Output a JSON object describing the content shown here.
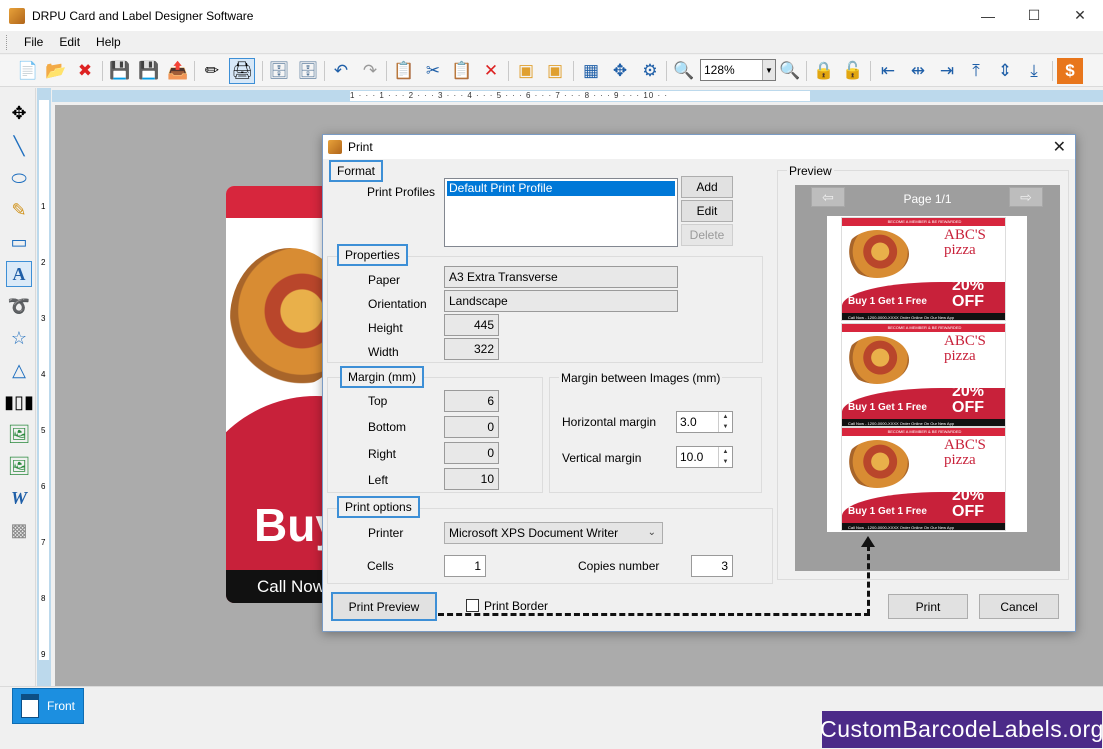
{
  "app": {
    "title": "DRPU Card and Label Designer Software",
    "win_minimize": "—",
    "win_maximize": "☐",
    "win_close": "✕"
  },
  "menu": [
    "File",
    "Edit",
    "Help"
  ],
  "toolbar": {
    "zoom_value": "128%",
    "ruler_marks": "1 · · · 1 · · · 2 · · · 3 · · · 4 · · · 5 · · · 6 · · · 7 · · · 8 · · · 9 · · · 10 · ·"
  },
  "ruler_v_marks": [
    "1",
    "2",
    "3",
    "4",
    "5",
    "6",
    "7",
    "8",
    "9"
  ],
  "canvas": {
    "card_text_buy": "Buy",
    "card_text_call": "Call Now"
  },
  "bottom": {
    "tab_front": "Front",
    "brand": "CustomBarcodeLabels.org"
  },
  "dialog": {
    "title": "Print",
    "format": {
      "heading": "Format",
      "profiles_label": "Print Profiles",
      "profiles": [
        "Default Print Profile"
      ],
      "add": "Add",
      "edit": "Edit",
      "delete": "Delete"
    },
    "properties": {
      "heading": "Properties",
      "paper_label": "Paper",
      "paper_value": "A3 Extra Transverse",
      "orientation_label": "Orientation",
      "orientation_value": "Landscape",
      "height_label": "Height",
      "height_value": "445",
      "width_label": "Width",
      "width_value": "322"
    },
    "margin": {
      "heading": "Margin (mm)",
      "top_label": "Top",
      "top_value": "6",
      "bottom_label": "Bottom",
      "bottom_value": "0",
      "right_label": "Right",
      "right_value": "0",
      "left_label": "Left",
      "left_value": "10"
    },
    "between": {
      "heading": "Margin between Images (mm)",
      "horizontal_label": "Horizontal margin",
      "horizontal_value": "3.0",
      "vertical_label": "Vertical margin",
      "vertical_value": "10.0"
    },
    "print_options": {
      "heading": "Print options",
      "printer_label": "Printer",
      "printer_value": "Microsoft XPS Document Writer",
      "cells_label": "Cells",
      "cells_value": "1",
      "copies_label": "Copies number",
      "copies_value": "3"
    },
    "preview": {
      "heading": "Preview",
      "page_label": "Page 1/1",
      "card": {
        "band": "BECOME A MEMBER & BE REWARDED",
        "name_line1": "ABC'S",
        "name_line2": "pizza",
        "discount_line1": "20%",
        "discount_line2": "OFF",
        "buy": "Buy 1 Get 1 Free",
        "footer": "Call Now - 1200-0000-XXXX      Order Online On Our New App"
      }
    },
    "print_preview_button": "Print Preview",
    "print_border_label": "Print Border",
    "print_button": "Print",
    "cancel_button": "Cancel"
  },
  "colors": {
    "accent": "#3d8fd6",
    "brand_bg": "#4b2a88",
    "card_red": "#d7263d",
    "selection": "#0078d7"
  }
}
